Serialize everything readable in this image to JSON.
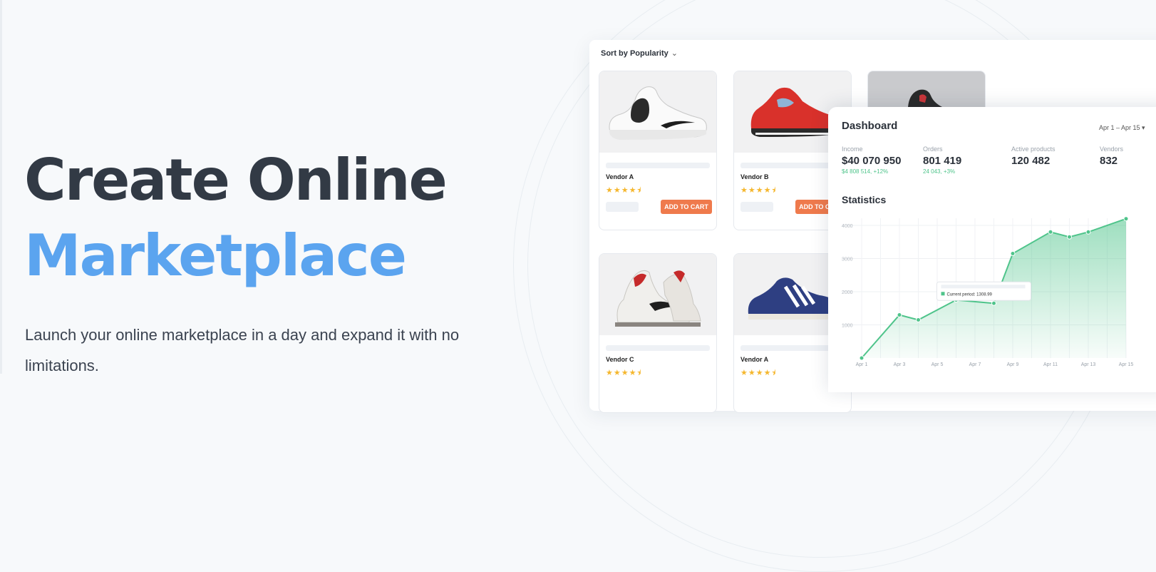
{
  "hero": {
    "title_line1": "Create Online",
    "title_line2": "Marketplace",
    "subtitle": "Launch your online marketplace in a day and expand it with no limitations."
  },
  "shop": {
    "sort_label": "Sort by Popularity",
    "products": [
      {
        "vendor": "Vendor A",
        "stars": "★★★★⯨",
        "button": "ADD TO CART",
        "image": "white-sneaker"
      },
      {
        "vendor": "Vendor B",
        "stars": "★★★★⯨",
        "button": "ADD TO CART",
        "image": "red-sneaker"
      },
      {
        "vendor": "",
        "stars": "",
        "button": "",
        "image": "dark-sneaker"
      },
      {
        "vendor": "Vendor C",
        "stars": "★★★★⯨",
        "button": "",
        "image": "high-top-sneaker"
      },
      {
        "vendor": "Vendor A",
        "stars": "★★★★⯨",
        "button": "",
        "image": "blue-sneaker"
      }
    ]
  },
  "dashboard": {
    "title": "Dashboard",
    "date_range": "Apr 1 – Apr 15 ▾",
    "metrics": [
      {
        "label": "Income",
        "value": "$40 070 950",
        "change": "$4 808 514, +12%"
      },
      {
        "label": "Orders",
        "value": "801 419",
        "change": "24 043, +3%"
      },
      {
        "label": "Active products",
        "value": "120 482",
        "change": ""
      },
      {
        "label": "Vendors",
        "value": "832",
        "change": ""
      }
    ],
    "statistics_title": "Statistics"
  },
  "colors": {
    "title_dark": "#323a45",
    "title_blue": "#5ba4ef",
    "button_orange": "#ef7a4c",
    "chart_green": "#4fc48b",
    "star_yellow": "#f5b72e"
  },
  "chart_data": {
    "type": "area",
    "title": "Statistics",
    "y_ticks": [
      "4000",
      "3000",
      "2000",
      "1000"
    ],
    "x": [
      "Apr 1",
      "Apr 2",
      "Apr 3",
      "Apr 4",
      "Apr 5",
      "Apr 6",
      "Apr 7",
      "Apr 8",
      "Apr 9",
      "Apr 10",
      "Apr 11",
      "Apr 12",
      "Apr 13",
      "Apr 14",
      "Apr 15"
    ],
    "x_tick_labels": [
      "Apr 1",
      "Apr 3",
      "Apr 5",
      "Apr 7",
      "Apr 9",
      "Apr 11",
      "Apr 13",
      "Apr 15"
    ],
    "values": [
      0,
      1300,
      1150,
      1750,
      1650,
      3150,
      3800,
      3650,
      3800,
      4200
    ],
    "value_x_index": [
      0,
      2,
      3,
      5,
      7,
      8,
      10,
      11,
      12,
      14
    ],
    "ylim": [
      0,
      4000
    ],
    "tooltip": "Current period: 1308.99",
    "grid": true
  }
}
